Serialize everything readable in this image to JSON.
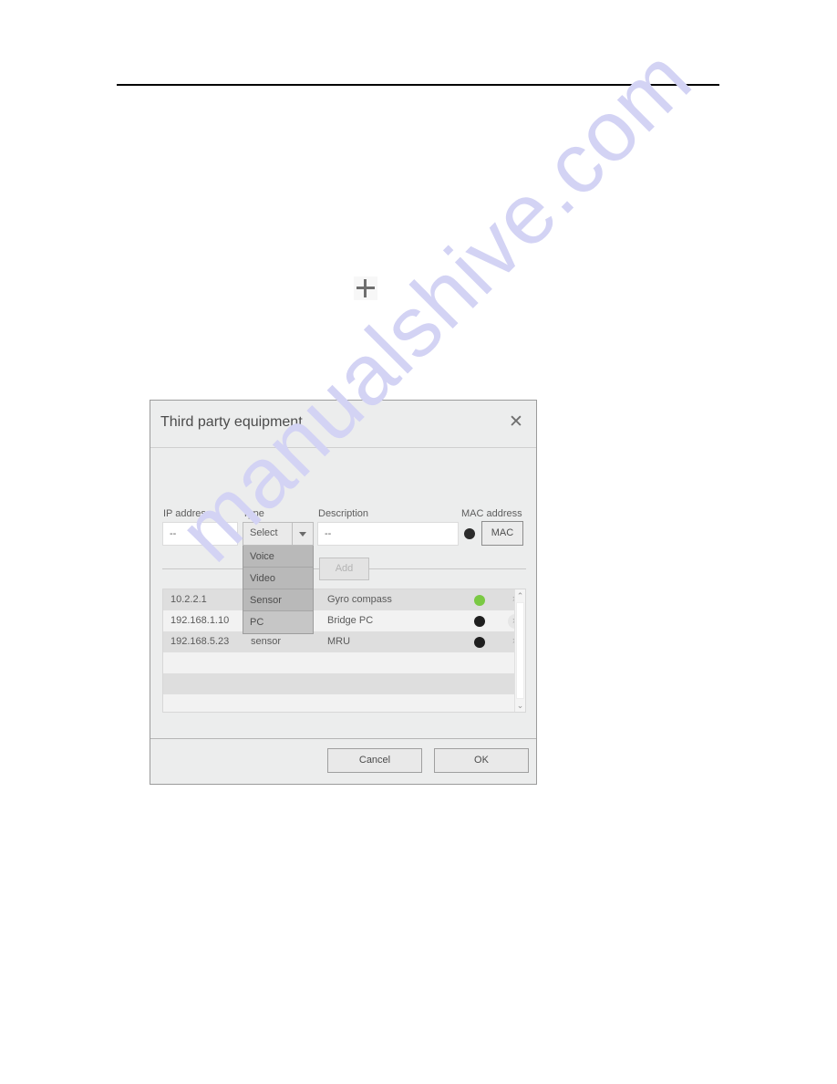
{
  "page": {
    "rule_present": true,
    "plus_icon": "plus-icon",
    "watermark": "manualshive.com",
    "watermark_color": "#d3d3f4"
  },
  "dialog": {
    "title": "Third party equipment",
    "close_icon": "✕",
    "form": {
      "labels": {
        "ip": "IP address",
        "type": "Type",
        "description": "Description",
        "mac": "MAC address"
      },
      "ip_value": "--",
      "ip_placeholder": "--",
      "description_value": "--",
      "description_placeholder": "--",
      "type_selected": "Select",
      "type_options": [
        {
          "label": "Voice",
          "highlighted": false
        },
        {
          "label": "Video",
          "highlighted": false
        },
        {
          "label": "Sensor",
          "highlighted": false
        },
        {
          "label": "PC",
          "highlighted": true
        }
      ],
      "mac_button_label": "MAC",
      "mac_led_color": "#2b2b2b",
      "add_button_label": "Add",
      "add_button_enabled": false
    },
    "table": {
      "rows": [
        {
          "ip": "10.2.2.1",
          "type": "Sensor",
          "description": "Gyro compass",
          "status_color": "#7ac943",
          "delete_icon": "×",
          "delete_hovered": false
        },
        {
          "ip": "192.168.1.10",
          "type": "PC",
          "description": "Bridge PC",
          "status_color": "#1f1f1f",
          "delete_icon": "×",
          "delete_hovered": true
        },
        {
          "ip": "192.168.5.23",
          "type": "sensor",
          "description": "MRU",
          "status_color": "#1f1f1f",
          "delete_icon": "×",
          "delete_hovered": false
        }
      ],
      "empty_row_count": 5,
      "scrollbar": {
        "up_icon": "⌃",
        "down_icon": "⌄"
      }
    },
    "footer": {
      "cancel_label": "Cancel",
      "ok_label": "OK"
    }
  }
}
